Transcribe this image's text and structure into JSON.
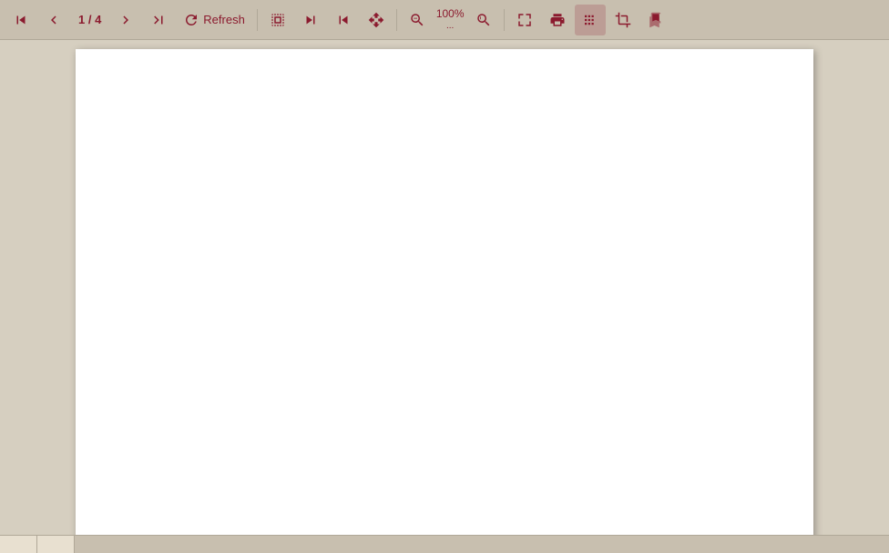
{
  "toolbar": {
    "page_indicator": "1 / 4",
    "refresh_label": "Refresh",
    "zoom_level": "100%",
    "zoom_dots": "...",
    "buttons": [
      {
        "name": "first-page",
        "label": "First page",
        "icon": "first"
      },
      {
        "name": "prev-page",
        "label": "Previous page",
        "icon": "prev"
      },
      {
        "name": "next-page",
        "label": "Next page",
        "icon": "next"
      },
      {
        "name": "last-page",
        "label": "Last page",
        "icon": "last"
      },
      {
        "name": "refresh",
        "label": "Refresh",
        "icon": "refresh"
      },
      {
        "name": "select-text",
        "label": "Select text",
        "icon": "select"
      },
      {
        "name": "pan-left",
        "label": "Pan left",
        "icon": "pan-left"
      },
      {
        "name": "pan-right",
        "label": "Pan right",
        "icon": "pan-right"
      },
      {
        "name": "move",
        "label": "Move",
        "icon": "move"
      },
      {
        "name": "zoom-out",
        "label": "Zoom out",
        "icon": "zoom-out"
      },
      {
        "name": "zoom-in",
        "label": "Zoom in",
        "icon": "zoom-in"
      },
      {
        "name": "fit-page",
        "label": "Fit page",
        "icon": "fit"
      },
      {
        "name": "print",
        "label": "Print",
        "icon": "print"
      },
      {
        "name": "thumbnail",
        "label": "Thumbnail view",
        "icon": "thumbnail"
      },
      {
        "name": "crop",
        "label": "Crop",
        "icon": "crop"
      },
      {
        "name": "bookmarks",
        "label": "Bookmarks",
        "icon": "bookmarks"
      }
    ]
  },
  "document": {
    "current_page": 1,
    "total_pages": 4
  },
  "bottom_tabs": [
    {
      "label": ""
    },
    {
      "label": ""
    }
  ]
}
